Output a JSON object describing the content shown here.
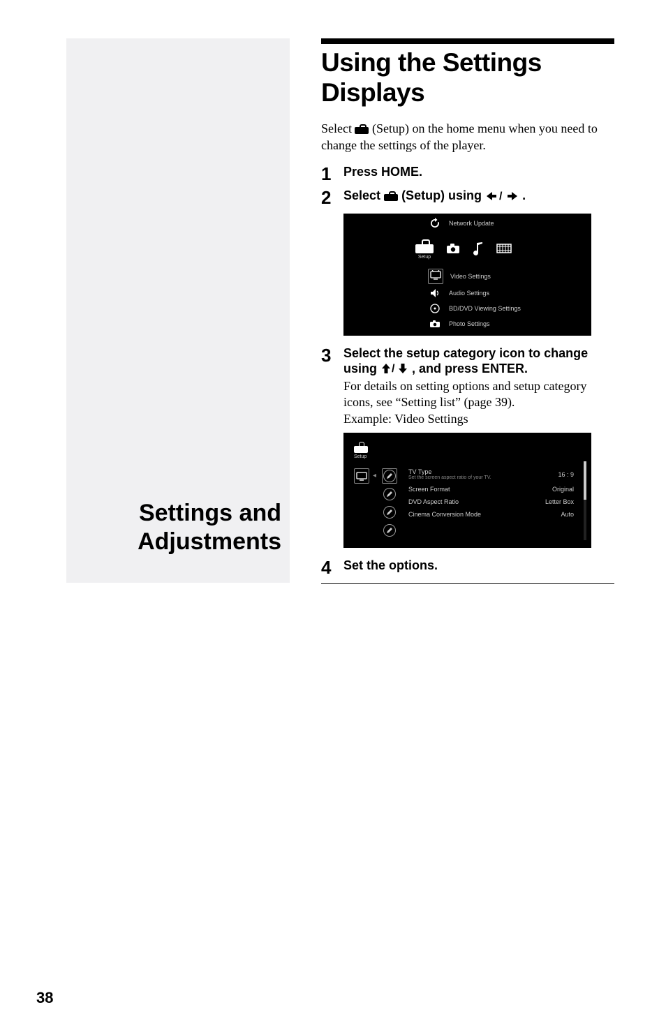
{
  "page_number": "38",
  "left": {
    "heading_l1": "Settings and",
    "heading_l2": "Adjustments"
  },
  "title": {
    "l1": "Using the Settings",
    "l2": "Displays"
  },
  "intro": {
    "before_icon": "Select ",
    "after_icon": " (Setup) on the home menu when you need to change the settings of the player."
  },
  "steps": {
    "s1": {
      "num": "1",
      "head": "Press HOME."
    },
    "s2": {
      "num": "2",
      "head_before": "Select ",
      "head_mid": " (Setup) using ",
      "head_after": "."
    },
    "s3": {
      "num": "3",
      "head_before": "Select the setup category icon to change using ",
      "head_after": ", and press ENTER.",
      "detail_l1": "For details on setting options and setup category icons, see “Setting list” (page 39).",
      "detail_l2": "Example: Video Settings"
    },
    "s4": {
      "num": "4",
      "head": "Set the options."
    }
  },
  "shot1": {
    "rows": [
      {
        "iconName": "refresh-icon",
        "label": "Network Update"
      },
      {
        "iconName": "toolbox-icon",
        "cap": "Setup",
        "is_setup_row": true
      },
      {
        "iconName": "tv-icon",
        "label": "Video Settings",
        "highlight": true
      },
      {
        "iconName": "speaker-icon",
        "label": "Audio Settings"
      },
      {
        "iconName": "disc-icon",
        "label": "BD/DVD Viewing Settings"
      },
      {
        "iconName": "camera-icon",
        "label": "Photo Settings"
      }
    ],
    "setup_neighbor_icons": [
      "camera-solid-icon",
      "music-note-icon",
      "film-icon"
    ]
  },
  "shot2": {
    "setup_cap": "Setup",
    "options": [
      {
        "label": "TV Type",
        "sub": "Set the screen aspect ratio of your TV.",
        "value": "16 : 9"
      },
      {
        "label": "Screen Format",
        "value": "Original"
      },
      {
        "label": "DVD Aspect Ratio",
        "value": "Letter Box"
      },
      {
        "label": "Cinema Conversion Mode",
        "value": "Auto"
      }
    ]
  }
}
